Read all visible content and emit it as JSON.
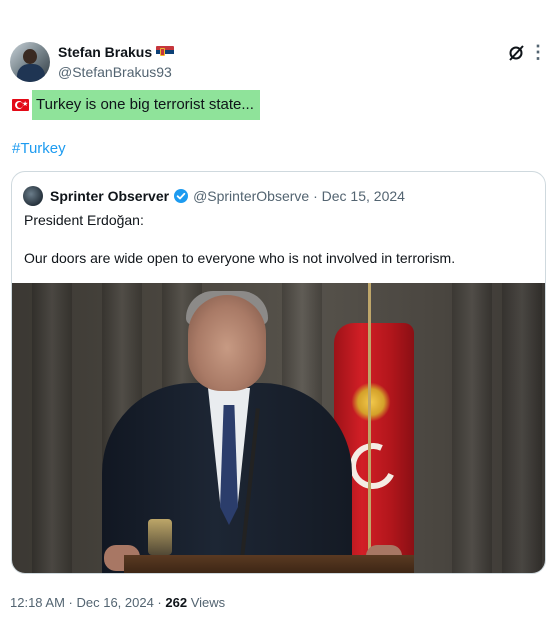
{
  "author": {
    "name": "Stefan Brakus",
    "handle": "@StefanBrakus93",
    "flag_icon": "serbia-flag-icon"
  },
  "post": {
    "flag_icon": "turkey-flag-icon",
    "text": "Turkey is one big terrorist state...",
    "highlight_color": "#8fe39a",
    "hashtag": "#Turkey"
  },
  "quote": {
    "name": "Sprinter Observer",
    "verified": true,
    "meta": "@SprinterObserve · Dec 15, 2024",
    "line1": "President Erdoğan:",
    "line2": "Our doors are wide open to everyone who is not involved in terrorism."
  },
  "footer": {
    "time": "12:18 AM · Dec 16, 2024 · ",
    "views_count": "262",
    "views_label": " Views"
  },
  "colors": {
    "accent": "#1d9bf0",
    "secondary_text": "#536471"
  }
}
